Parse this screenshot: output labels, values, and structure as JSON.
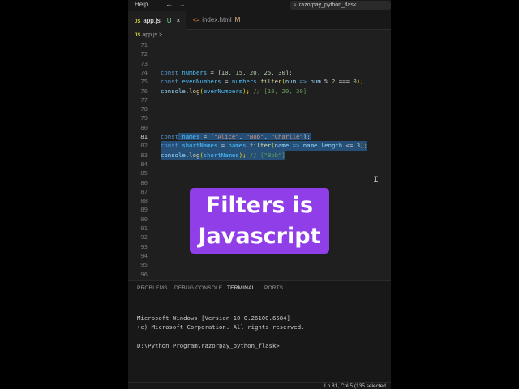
{
  "titlebar": {
    "menu_help": "Help",
    "back_arrow": "←",
    "forward_arrow": "→",
    "search_text": "razorpay_python_flask",
    "search_icon": "search-icon"
  },
  "tabs": [
    {
      "icon": "JS",
      "label": "app.js",
      "badge": "U",
      "close": "×"
    },
    {
      "icon": "<>",
      "label": "index.html",
      "badge": "M"
    }
  ],
  "breadcrumb": {
    "icon": "JS",
    "file": "app.js",
    "sep": ">",
    "more": "..."
  },
  "editor": {
    "line_numbers": [
      "71",
      "72",
      "73",
      "74",
      "75",
      "76",
      "77",
      "78",
      "79",
      "80",
      "81",
      "82",
      "83",
      "84",
      "85",
      "86",
      "87",
      "88",
      "89",
      "90",
      "91",
      "92",
      "93",
      "94",
      "95",
      "96"
    ],
    "line74": {
      "kw": "const",
      "var": "numbers",
      "eq": " = [",
      "n1": "10",
      "c1": ", ",
      "n2": "15",
      "c2": ", ",
      "n3": "20",
      "c3": ", ",
      "n4": "25",
      "c4": ", ",
      "n5": "30",
      "end": "];"
    },
    "line75": {
      "kw": "const",
      "var": "evenNumbers",
      "eq": " = ",
      "obj": "numbers",
      "dot": ".",
      "fn": "filter",
      "open": "(",
      "param": "num",
      "arrow": " => ",
      "param2": "num",
      "mod": " % ",
      "n2": "2",
      "eqeq": " === ",
      "n0": "0",
      "close": ");"
    },
    "line76": {
      "obj": "console",
      "dot": ".",
      "fn": "log",
      "open": "(",
      "arg": "evenNumbers",
      "close": "); ",
      "comment": "// [10, 20, 30]"
    },
    "line81": {
      "kw": "const",
      "var": "names",
      "eq": " = [",
      "s1": "\"Alice\"",
      "c1": ", ",
      "s2": "\"Bob\"",
      "c2": ", ",
      "s3": "\"Charlie\"",
      "end": "];"
    },
    "line82": {
      "kw": "const",
      "var": "shortNames",
      "eq": " = ",
      "obj": "names",
      "dot": ".",
      "fn": "filter",
      "open": "(",
      "param": "name",
      "arrow": " => ",
      "param2": "name",
      "dot2": ".",
      "prop": "length",
      "le": " <= ",
      "n3": "3",
      "close": ");"
    },
    "line83": {
      "obj": "console",
      "dot": ".",
      "fn": "log",
      "open": "(",
      "arg": "shortNames",
      "close": "); ",
      "comment": "// [\"Bob\"]"
    }
  },
  "caption": {
    "line1": "Filters is",
    "line2": "Javascript"
  },
  "panel": {
    "tabs": [
      "PROBLEMS",
      "DEBUG CONSOLE",
      "TERMINAL",
      "PORTS"
    ],
    "active_tab": "TERMINAL",
    "terminal_lines": [
      "Microsoft Windows [Version 10.0.26100.6584]",
      "(c) Microsoft Corporation. All rights reserved.",
      "",
      "D:\\Python Program\\razorpay_python_flask>"
    ]
  },
  "statusbar": {
    "position": "Ln 81, Col 5 (135 selected"
  },
  "colors": {
    "accent": "#0078d4",
    "caption_bg": "#8f3ee8",
    "selection": "#264f78",
    "editor_bg": "#1f1f1f"
  }
}
